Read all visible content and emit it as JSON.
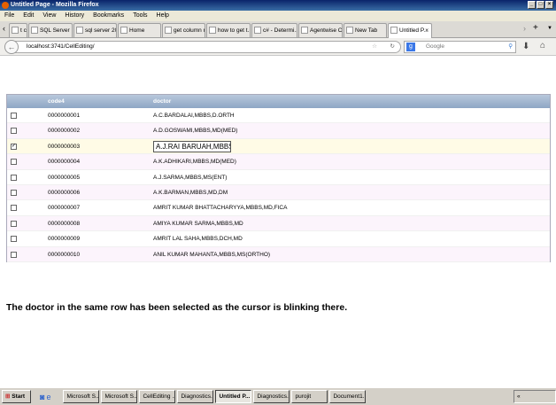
{
  "window": {
    "title": "Untitled Page - Mozilla Firefox"
  },
  "menu": [
    "File",
    "Edit",
    "View",
    "History",
    "Bookmarks",
    "Tools",
    "Help"
  ],
  "tabs": [
    "t col...",
    "SQL Server F...",
    "sql server 20...",
    "Home",
    "get column n...",
    "how to get t...",
    "c# - Determi...",
    "Agentwise C...",
    "New Tab",
    "Untitled P..."
  ],
  "address": {
    "url": "localhost:3741/CellEditing/",
    "search_placeholder": "Google"
  },
  "grid": {
    "columns": [
      "code4",
      "doctor"
    ],
    "rows": [
      {
        "checked": false,
        "code": "0000000001",
        "doctor": "A.C.BARDALAI,MBBS,D.ORTH"
      },
      {
        "checked": false,
        "code": "0000000002",
        "doctor": "A.D.GOSWAMI,MBBS,MD(MED)"
      },
      {
        "checked": true,
        "code": "0000000003",
        "doctor": "A.J.RAI BARUAH,MBBS"
      },
      {
        "checked": false,
        "code": "0000000004",
        "doctor": "A.K.ADHIKARI,MBBS,MD(MED)"
      },
      {
        "checked": false,
        "code": "0000000005",
        "doctor": "A.J.SARMA,MBBS,MS(ENT)"
      },
      {
        "checked": false,
        "code": "0000000006",
        "doctor": "A.K.BARMAN,MBBS,MD,DM"
      },
      {
        "checked": false,
        "code": "0000000007",
        "doctor": "AMRIT KUMAR BHATTACHARYYA,MBBS,MD,FICA"
      },
      {
        "checked": false,
        "code": "0000000008",
        "doctor": "AMIYA KUMAR SARMA,MBBS,MD"
      },
      {
        "checked": false,
        "code": "0000000009",
        "doctor": "AMRIT LAL SAHA,MBBS,DCH,MD"
      },
      {
        "checked": false,
        "code": "0000000010",
        "doctor": "ANIL KUMAR MAHANTA,MBBS,MS(ORTHO)"
      }
    ]
  },
  "caption": "The doctor in the same row has been selected as the cursor is blinking there.",
  "taskbar": {
    "start": "Start",
    "items": [
      "Microsoft S...",
      "Microsoft S...",
      "CellEditing ...",
      "Diagnostics...",
      "Untitled P...",
      "Diagnostics...",
      "purojit",
      "Document1..."
    ],
    "tray": "«"
  }
}
